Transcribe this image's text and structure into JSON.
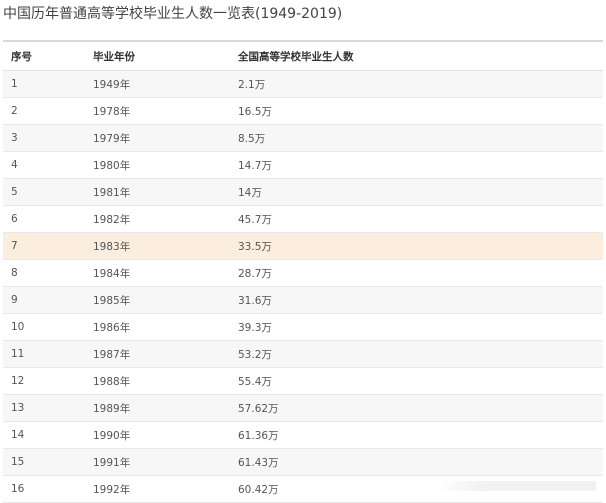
{
  "title": "中国历年普通高等学校毕业生人数一览表(1949-2019)",
  "table": {
    "headers": [
      "序号",
      "毕业年份",
      "全国高等学校毕业生人数"
    ],
    "rows": [
      [
        "1",
        "1949年",
        "2.1万"
      ],
      [
        "2",
        "1978年",
        "16.5万"
      ],
      [
        "3",
        "1979年",
        "8.5万"
      ],
      [
        "4",
        "1980年",
        "14.7万"
      ],
      [
        "5",
        "1981年",
        "14万"
      ],
      [
        "6",
        "1982年",
        "45.7万"
      ],
      [
        "7",
        "1983年",
        "33.5万"
      ],
      [
        "8",
        "1984年",
        "28.7万"
      ],
      [
        "9",
        "1985年",
        "31.6万"
      ],
      [
        "10",
        "1986年",
        "39.3万"
      ],
      [
        "11",
        "1987年",
        "53.2万"
      ],
      [
        "12",
        "1988年",
        "55.4万"
      ],
      [
        "13",
        "1989年",
        "57.62万"
      ],
      [
        "14",
        "1990年",
        "61.36万"
      ],
      [
        "15",
        "1991年",
        "61.43万"
      ],
      [
        "16",
        "1992年",
        "60.42万"
      ]
    ],
    "highlighted_row": 7
  },
  "colors": {
    "highlight": "#fbeede",
    "stripe": "#f7f7f7",
    "border": "#d9d9d9"
  }
}
